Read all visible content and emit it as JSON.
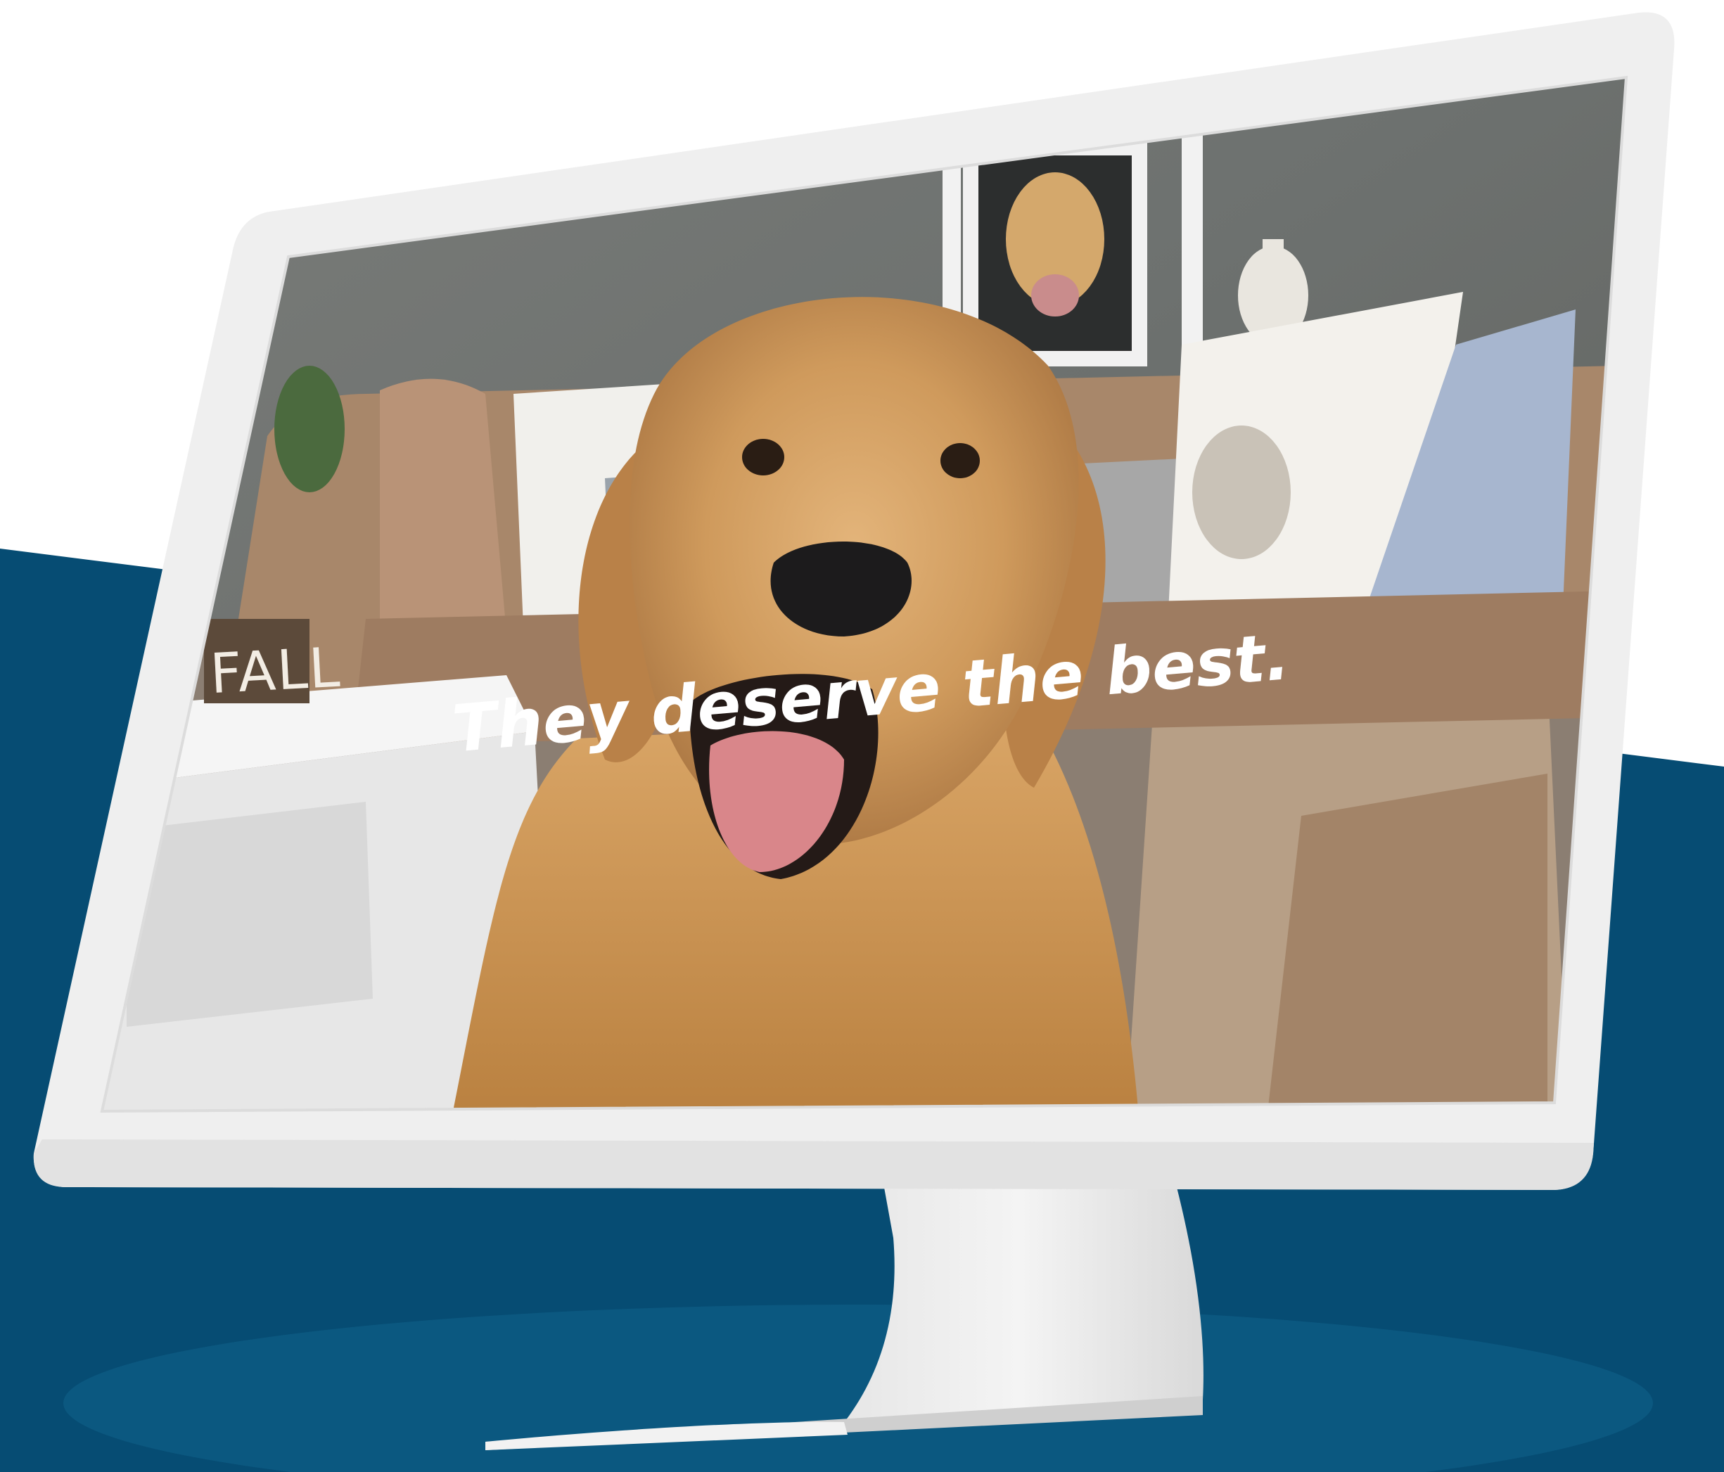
{
  "hero": {
    "tagline": "They deserve the best."
  },
  "background_sign": {
    "text": "FALL"
  },
  "colors": {
    "panel_blue": "#064c73",
    "glow_blue": "#0d5a82",
    "monitor_white": "#efefef",
    "tagline_text": "#ffffff"
  }
}
